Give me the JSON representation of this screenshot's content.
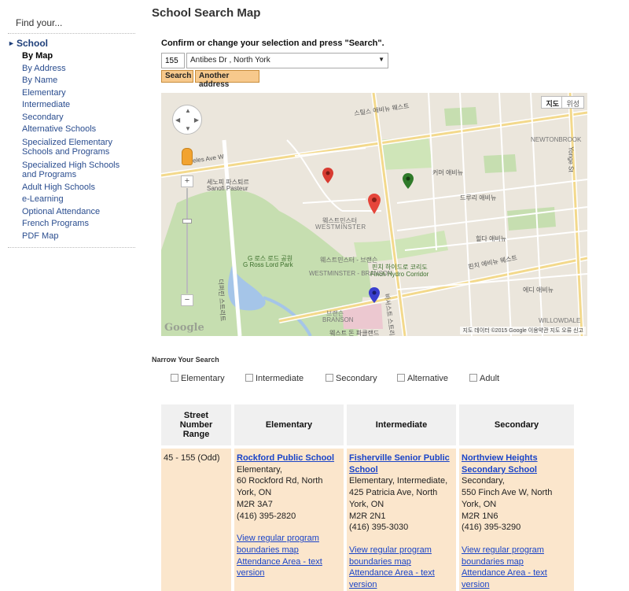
{
  "sidebar": {
    "find_your": "Find your...",
    "section": "School",
    "items": [
      {
        "label": "By Map",
        "active": true
      },
      {
        "label": "By Address"
      },
      {
        "label": "By Name"
      },
      {
        "label": "Elementary"
      },
      {
        "label": "Intermediate"
      },
      {
        "label": "Secondary"
      },
      {
        "label": "Alternative Schools"
      },
      {
        "label": "Specialized Elementary Schools and Programs"
      },
      {
        "label": "Specialized High Schools and Programs"
      },
      {
        "label": "Adult High Schools"
      },
      {
        "label": "e-Learning"
      },
      {
        "label": "Optional Attendance"
      },
      {
        "label": "French Programs"
      },
      {
        "label": "PDF Map"
      }
    ]
  },
  "page": {
    "title": "School Search Map",
    "confirm_text": "Confirm or change your selection and press \"Search\".",
    "street_number": "155",
    "street_select": "Antibes Dr , North York",
    "search_button": "Search",
    "another_button": "Another address"
  },
  "map": {
    "map_type_map": "지도",
    "map_type_satellite": "위성",
    "credit": "지도 데이터 ©2015 Google   이용약관   지도 오류 신고",
    "logo": "Google",
    "labels": {
      "steeles": "Steeles Ave W",
      "steeles_kr": "스틸스 애비뉴 웨스트",
      "sanofi_kr": "세노피 파스퇴르",
      "sanofi": "Sanofi Pasteur",
      "westminster_kr": "웨스트민스터",
      "westminster": "WESTMINSTER",
      "westminster_branson_kr": "웨스트민스터 - 브랜슨",
      "westminster_branson": "WESTMINSTER - BRANSON",
      "ross_lord_kr": "G 로스 로드 공원",
      "ross_lord": "G Ross Lord Park",
      "finch_hydro_kr": "핀치 하이드로 코리도",
      "finch_hydro": "Finch Hydro Corridor",
      "finch_kr": "핀치 애비뉴 웨스트",
      "branson_kr": "브랜슨",
      "branson": "BRANSON",
      "newtonbrook": "NEWTONBROOK",
      "yonge": "Yonge St",
      "willowdale": "WILLOWDALE",
      "drewry_kr": "드루리 애비뉴",
      "cummer_kr": "커머 애비뉴",
      "hilda_kr": "힐다 애비뉴",
      "bathurst_kr": "바서스트 스트리트",
      "dufferin_kr": "더퍼린 스트리트",
      "westdon_kr": "웨스트 돈 파클랜드",
      "ede_kr": "에디 애비뉴"
    }
  },
  "narrow": {
    "title": "Narrow Your Search",
    "filters": [
      "Elementary",
      "Intermediate",
      "Secondary",
      "Alternative",
      "Adult"
    ]
  },
  "results": {
    "headers": [
      "Street Number Range",
      "Elementary",
      "Intermediate",
      "Secondary"
    ],
    "range": "45 - 155 (Odd)",
    "schools": [
      {
        "name": "Rockford Public School",
        "type": "Elementary,",
        "address": "60 Rockford Rd, North York, ON",
        "postal": "M2R 3A7",
        "phone": "(416) 395-2820",
        "map_link": "View regular program boundaries map",
        "text_link": "Attendance Area - text version"
      },
      {
        "name": "Fisherville Senior Public School",
        "type": "Elementary, Intermediate,",
        "address": "425 Patricia Ave, North York, ON",
        "postal": "M2R 2N1",
        "phone": "(416) 395-3030",
        "map_link": "View regular program boundaries map",
        "text_link": "Attendance Area - text version"
      },
      {
        "name": "Northview Heights Secondary School",
        "type": "Secondary,",
        "address": "550 Finch Ave W, North York, ON",
        "postal": "M2R 1N6",
        "phone": "(416) 395-3290",
        "map_link": "View regular program boundaries map",
        "text_link": "Attendance Area - text version"
      }
    ]
  }
}
